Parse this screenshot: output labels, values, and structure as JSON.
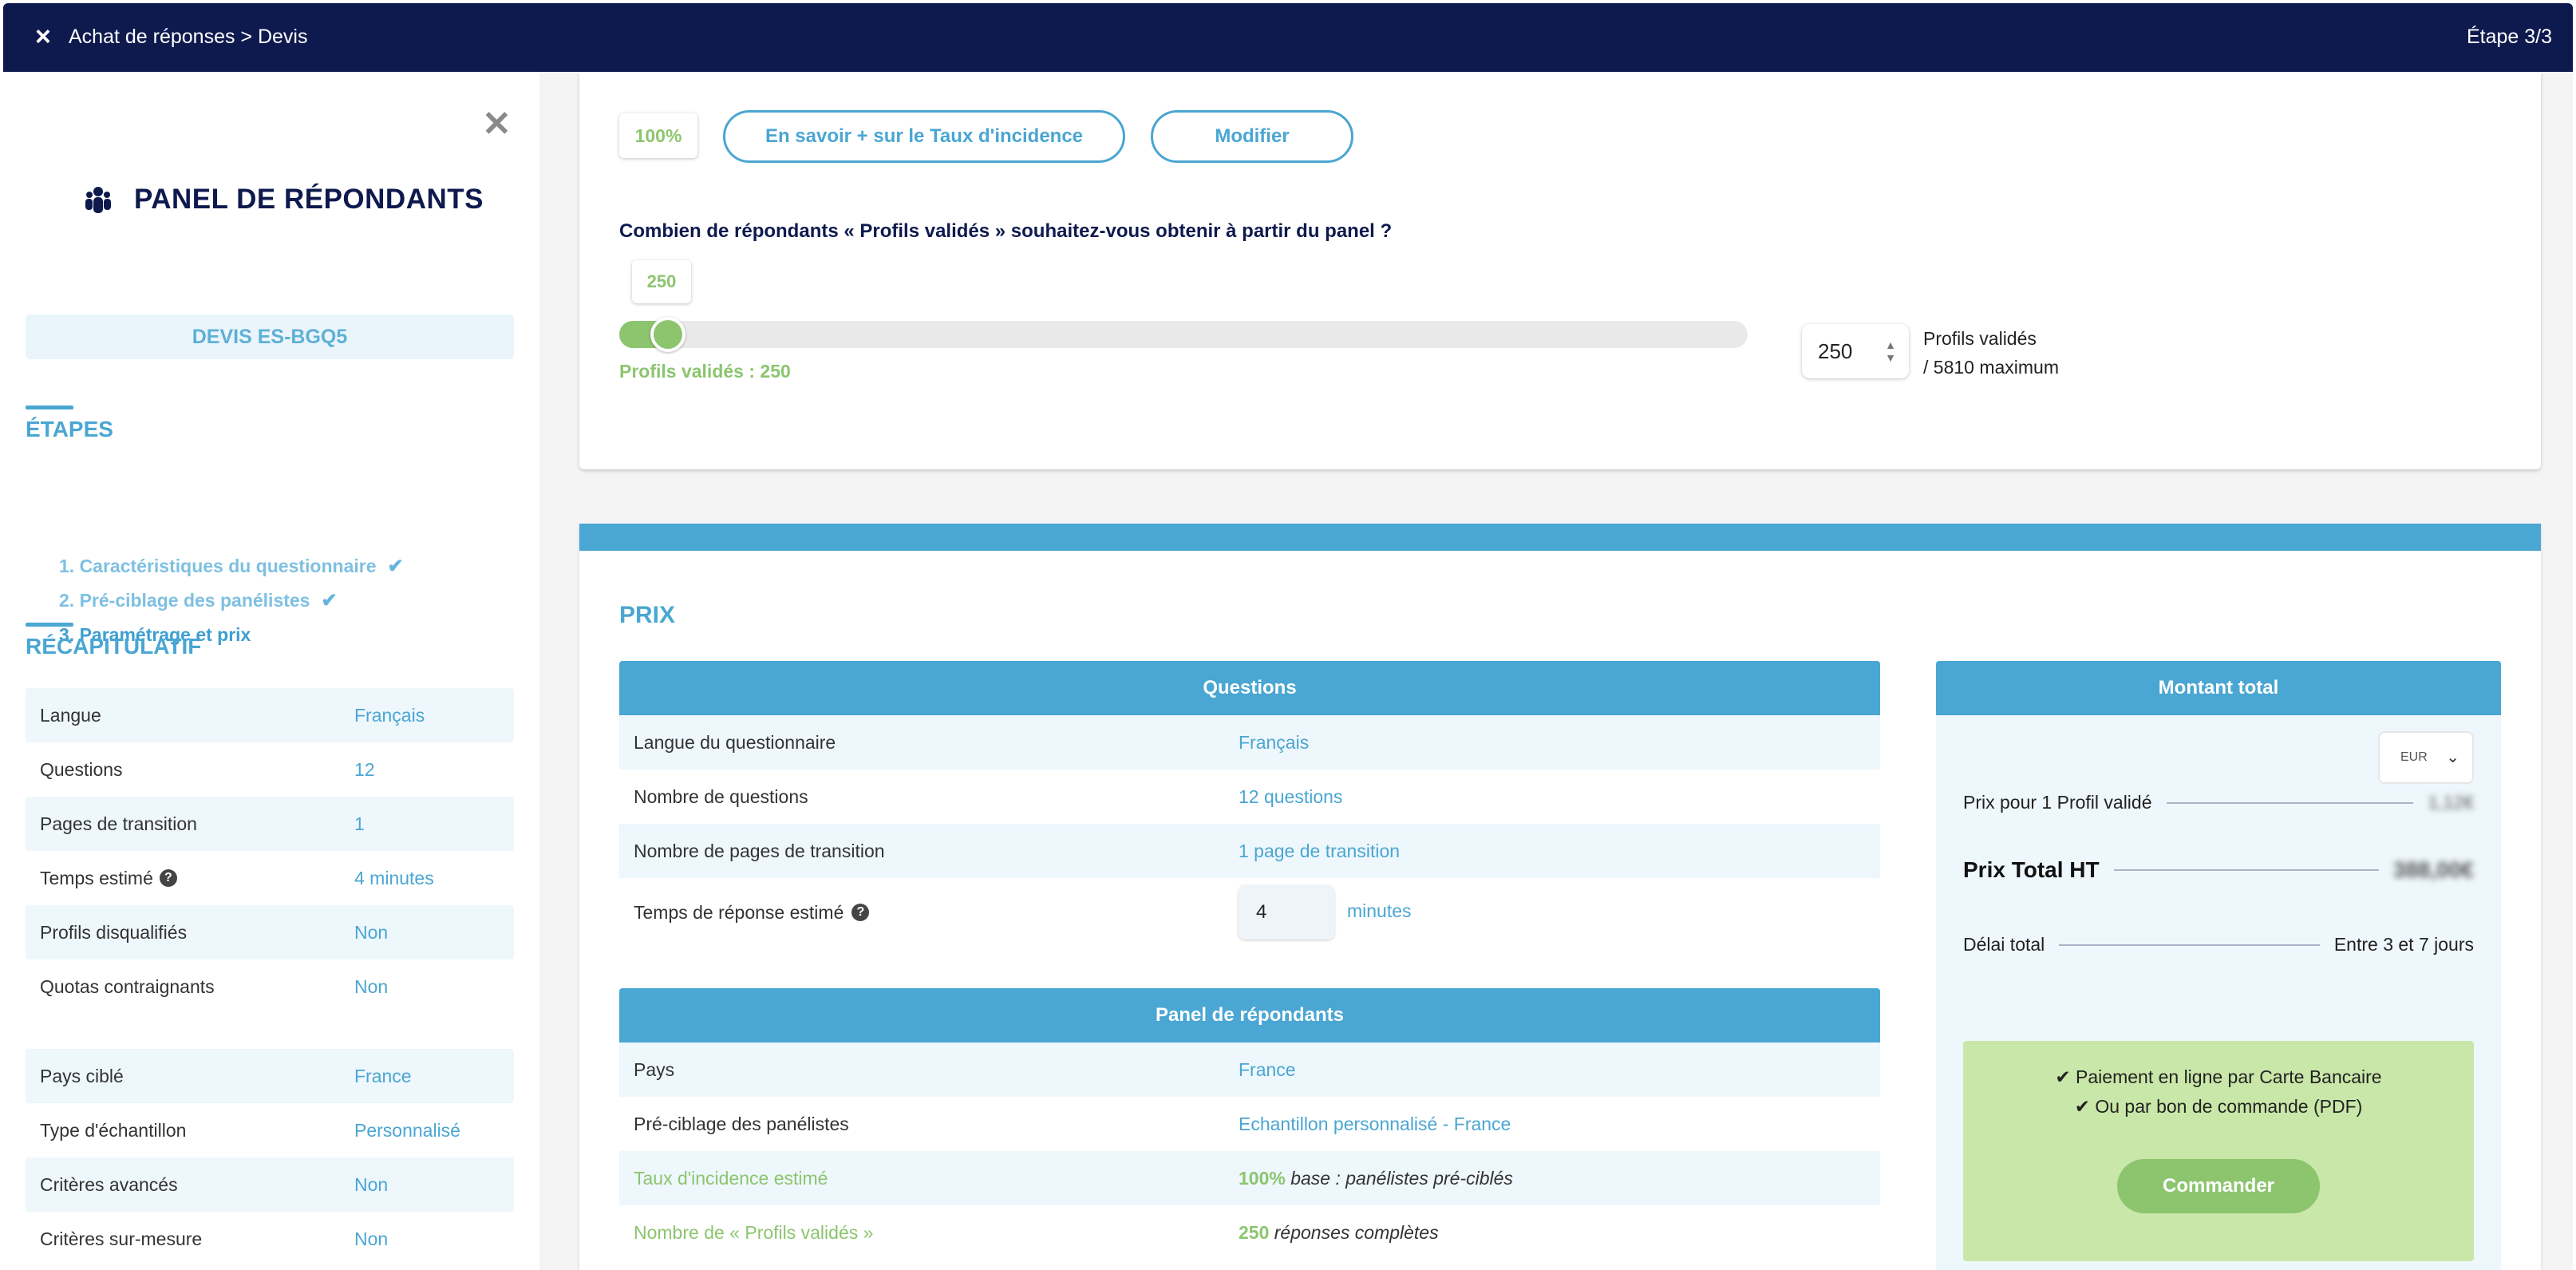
{
  "header": {
    "breadcrumb": "Achat de réponses > Devis",
    "step": "Étape 3/3"
  },
  "sidebar": {
    "title": "PANEL DE RÉPONDANTS",
    "devis": "DEVIS ES-BGQ5",
    "steps_title": "ÉTAPES",
    "steps": [
      {
        "label": "1. Caractéristiques du questionnaire",
        "done": true
      },
      {
        "label": "2. Pré-ciblage des panélistes",
        "done": true
      },
      {
        "label": "3. Paramétrage et prix",
        "done": false
      }
    ],
    "recap_title": "RÉCAPITULATIF",
    "recap1": [
      {
        "k": "Langue",
        "v": "Français"
      },
      {
        "k": "Questions",
        "v": "12"
      },
      {
        "k": "Pages de transition",
        "v": "1"
      },
      {
        "k": "Temps estimé",
        "v": "4 minutes"
      },
      {
        "k": "Profils disqualifiés",
        "v": "Non"
      },
      {
        "k": "Quotas contraignants",
        "v": "Non"
      }
    ],
    "recap2": [
      {
        "k": "Pays ciblé",
        "v": "France"
      },
      {
        "k": "Type d'échantillon",
        "v": "Personnalisé"
      },
      {
        "k": "Critères avancés",
        "v": "Non"
      },
      {
        "k": "Critères sur-mesure",
        "v": "Non"
      }
    ]
  },
  "incidence": {
    "badge": "100%",
    "learn_more": "En savoir + sur le Taux d'incidence",
    "modify": "Modifier",
    "question": "Combien de répondants « Profils validés » souhaitez-vous obtenir à partir du panel ?",
    "slider_value": "250",
    "slider_fraction": 0.043,
    "slider_caption": "Profils validés : 250",
    "input_value": "250",
    "max_line1": "Profils validés",
    "max_line2": "/ 5810 maximum"
  },
  "prix": {
    "title": "PRIX",
    "questions_header": "Questions",
    "questions": [
      {
        "k": "Langue du questionnaire",
        "v": "Français"
      },
      {
        "k": "Nombre de questions",
        "v": "12 questions"
      },
      {
        "k": "Nombre de pages de transition",
        "v": "1 page de transition"
      }
    ],
    "time_label": "Temps de réponse estimé",
    "time_value": "4",
    "time_unit": "minutes",
    "panel_header": "Panel de répondants",
    "panel": [
      {
        "k": "Pays",
        "v": "France"
      },
      {
        "k": "Pré-ciblage des panélistes",
        "v": "Echantillon personnalisé - France"
      }
    ],
    "incidence_label": "Taux d'incidence estimé",
    "incidence_value": "100%",
    "incidence_note": "base : panélistes pré-ciblés",
    "profils_label": "Nombre de « Profils validés »",
    "profils_value": "250",
    "profils_note": "réponses complètes"
  },
  "total": {
    "header": "Montant total",
    "currency": "EUR",
    "unit_price_label": "Prix pour 1 Profil validé",
    "unit_price_value": "1,12€",
    "total_label": "Prix Total HT",
    "total_value": "388,00€",
    "delay_label": "Délai total",
    "delay_value": "Entre 3 et 7 jours",
    "pay1": "Paiement en ligne par Carte Bancaire",
    "pay2": "Ou par bon de commande (PDF)",
    "order_button": "Commander"
  },
  "colors": {
    "navy": "#0e1a4e",
    "blue": "#4aa6d2",
    "green": "#8cc56e"
  }
}
